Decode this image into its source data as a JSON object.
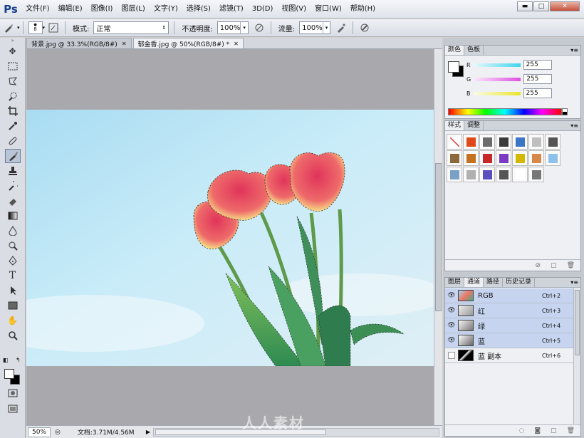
{
  "app": {
    "logo": "Ps"
  },
  "menu": [
    "文件(F)",
    "编辑(E)",
    "图像(I)",
    "图层(L)",
    "文字(Y)",
    "选择(S)",
    "滤镜(T)",
    "3D(D)",
    "视图(V)",
    "窗口(W)",
    "帮助(H)"
  ],
  "window_controls": {
    "minimize": "▬",
    "maximize": "□",
    "close": "✕"
  },
  "options": {
    "brush_size": "8",
    "mode_label": "模式:",
    "mode_value": "正常",
    "opacity_label": "不透明度:",
    "opacity_value": "100%",
    "flow_label": "流量:",
    "flow_value": "100%"
  },
  "documents": [
    {
      "title": "背景.jpg @ 33.3%(RGB/8#)",
      "close": "✕",
      "active": false
    },
    {
      "title": "郁金香.jpg @ 50%(RGB/8#) *",
      "close": "✕",
      "active": true
    }
  ],
  "status": {
    "zoom": "50%",
    "doc_info": "文档:3.71M/4.56M"
  },
  "watermark": "人人素材",
  "color_panel": {
    "tabs": [
      "颜色",
      "色板"
    ],
    "channels": [
      {
        "label": "R",
        "value": "255",
        "gradient_from": "#e8f8fb",
        "gradient_to": "#3fd6ec"
      },
      {
        "label": "G",
        "value": "255",
        "gradient_from": "#fbe8fb",
        "gradient_to": "#e04fe0"
      },
      {
        "label": "B",
        "value": "255",
        "gradient_from": "#fbfbe6",
        "gradient_to": "#e9e62a"
      }
    ]
  },
  "styles_panel": {
    "tabs": [
      "样式",
      "调整"
    ],
    "swatches": [
      "#ffffff",
      "#e04a1a",
      "#6b6b6b",
      "#3a3a3a",
      "#3c74c6",
      "#bfbfbf",
      "#555555",
      "#8a6a3a",
      "#c4721f",
      "#c62828",
      "#7a3ac4",
      "#d4b800",
      "#d8894a",
      "#8cc2ea",
      "#7aa0c8",
      "#b0b0b0",
      "#5b4fbf",
      "#555555",
      "#ffffff",
      "#777777"
    ],
    "footer": [
      "⊘",
      "▢",
      "🗑"
    ]
  },
  "channels_panel": {
    "tabs": [
      "图层",
      "通道",
      "路径",
      "历史记录"
    ],
    "rows": [
      {
        "name": "RGB",
        "shortcut": "Ctrl+2",
        "visible": true,
        "selected": true
      },
      {
        "name": "红",
        "shortcut": "Ctrl+3",
        "visible": true,
        "selected": true
      },
      {
        "name": "绿",
        "shortcut": "Ctrl+4",
        "visible": true,
        "selected": true
      },
      {
        "name": "蓝",
        "shortcut": "Ctrl+5",
        "visible": true,
        "selected": true
      },
      {
        "name": "蓝 副本",
        "shortcut": "Ctrl+6",
        "visible": false,
        "selected": false
      }
    ],
    "footer": [
      "◌",
      "◙",
      "▢",
      "🗑"
    ]
  }
}
